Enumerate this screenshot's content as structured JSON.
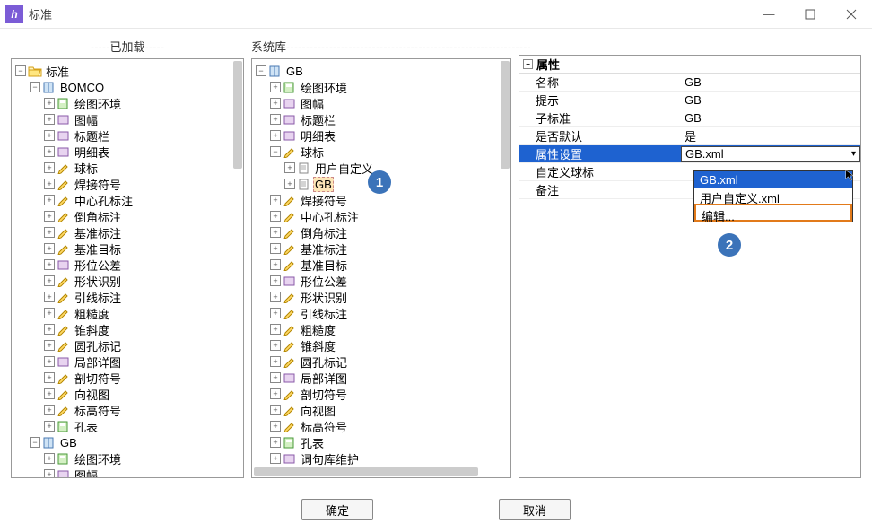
{
  "window": {
    "title": "标准",
    "min": "—",
    "max": "□",
    "close": "✕"
  },
  "labels": {
    "loaded": "-----已加载-----",
    "syslib": "系统库---------------------------------------------------------------"
  },
  "left": {
    "root": "标准",
    "bomco": "BOMCO",
    "gb_node": "GB",
    "items_bomco": [
      "绘图环境",
      "图幅",
      "标题栏",
      "明细表",
      "球标",
      "焊接符号",
      "中心孔标注",
      "倒角标注",
      "基准标注",
      "基准目标",
      "形位公差",
      "形状识别",
      "引线标注",
      "粗糙度",
      "锥斜度",
      "圆孔标记",
      "局部详图",
      "剖切符号",
      "向视图",
      "标高符号",
      "孔表"
    ],
    "items_gb": [
      "绘图环境",
      "图幅"
    ]
  },
  "mid": {
    "root": "GB",
    "items_before": [
      "绘图环境",
      "图幅",
      "标题栏",
      "明细表"
    ],
    "ball": "球标",
    "user_custom": "用户自定义",
    "gb_leaf": "GB",
    "items_after": [
      "焊接符号",
      "中心孔标注",
      "倒角标注",
      "基准标注",
      "基准目标",
      "形位公差",
      "形状识别",
      "引线标注",
      "粗糙度",
      "锥斜度",
      "圆孔标记",
      "局部详图",
      "剖切符号",
      "向视图",
      "标高符号",
      "孔表",
      "词句库维护"
    ]
  },
  "right": {
    "header": "属性",
    "rows": [
      {
        "k": "名称",
        "v": "GB"
      },
      {
        "k": "提示",
        "v": "GB"
      },
      {
        "k": "子标准",
        "v": "GB"
      },
      {
        "k": "是否默认",
        "v": "是"
      },
      {
        "k": "属性设置",
        "v": "GB.xml"
      },
      {
        "k": "自定义球标",
        "v": ""
      },
      {
        "k": "备注",
        "v": ""
      }
    ],
    "combo": {
      "opt1": "GB.xml",
      "opt2": "用户自定义.xml",
      "edit": "编辑..."
    }
  },
  "footer": {
    "ok": "确定",
    "cancel": "取消"
  },
  "badges": {
    "one": "1",
    "two": "2"
  }
}
